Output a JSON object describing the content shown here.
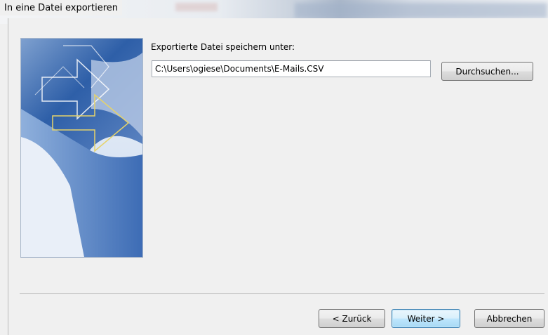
{
  "window": {
    "title": "In eine Datei exportieren"
  },
  "main": {
    "label": "Exportierte Datei speichern unter:",
    "path_value": "C:\\Users\\ogiese\\Documents\\E-Mails.CSV",
    "browse_label": "Durchsuchen..."
  },
  "footer": {
    "back_label": "< Zurück",
    "next_label": "Weiter >",
    "cancel_label": "Abbrechen"
  },
  "colors": {
    "banner_blue": "#2e5fa8",
    "banner_light": "#c9d9ee",
    "arrow_yellow": "#e6d36a",
    "default_button_border": "#3c7fb1"
  },
  "icons": [
    "export-wizard-banner"
  ]
}
